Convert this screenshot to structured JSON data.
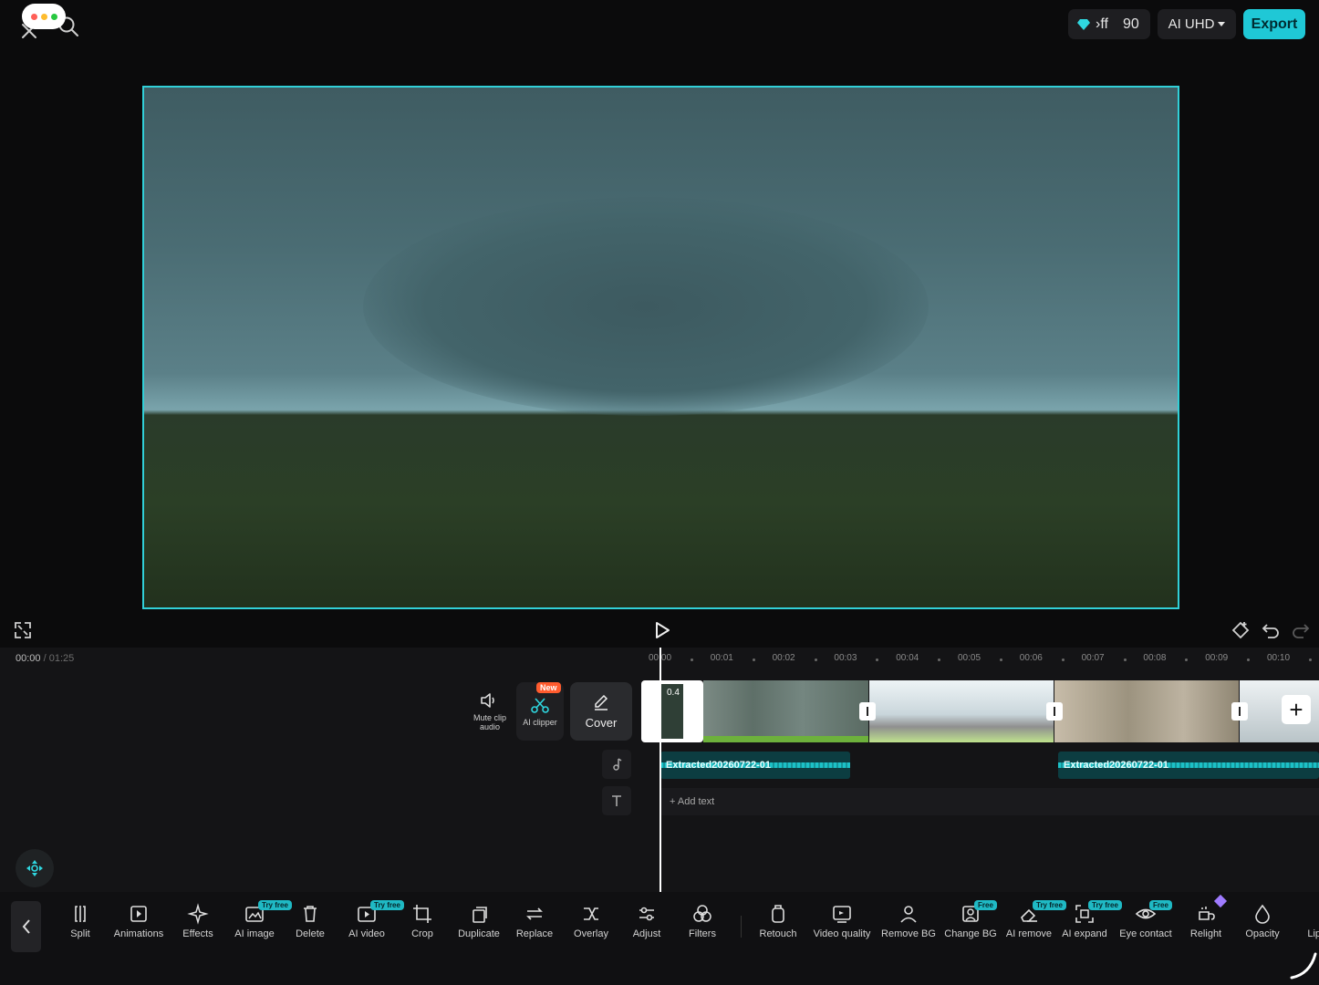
{
  "header": {
    "pro_label": "›ff",
    "credits": "90",
    "quality_label": "AI UHD",
    "export_label": "Export"
  },
  "player": {
    "current_time": "00:00",
    "separator": "/",
    "duration": "01:25"
  },
  "ruler": {
    "ticks": [
      "00:00",
      "00:01",
      "00:02",
      "00:03",
      "00:04",
      "00:05",
      "00:06",
      "00:07",
      "00:08",
      "00:09",
      "00:10"
    ]
  },
  "track_tools": {
    "mute_label": "Mute clip audio",
    "clipper_label": "AI clipper",
    "clipper_badge": "New",
    "cover_label": "Cover"
  },
  "timeline": {
    "clip_a_label": "0.4",
    "audio_clip_1": "Extracted20260722-01",
    "audio_clip_2": "Extracted20260722-01",
    "add_text_label": "+ Add text"
  },
  "toolbar": {
    "tools": [
      {
        "label": "Split",
        "badge": "",
        "icon": "split-icon"
      },
      {
        "label": "Animations",
        "badge": "",
        "icon": "animations-icon"
      },
      {
        "label": "Effects",
        "badge": "",
        "icon": "effects-icon"
      },
      {
        "label": "AI image",
        "badge": "Try free",
        "icon": "ai-image-icon"
      },
      {
        "label": "Delete",
        "badge": "",
        "icon": "delete-icon"
      },
      {
        "label": "AI video",
        "badge": "Try free",
        "icon": "ai-video-icon"
      },
      {
        "label": "Crop",
        "badge": "",
        "icon": "crop-icon"
      },
      {
        "label": "Duplicate",
        "badge": "",
        "icon": "duplicate-icon"
      },
      {
        "label": "Replace",
        "badge": "",
        "icon": "replace-icon"
      },
      {
        "label": "Overlay",
        "badge": "",
        "icon": "overlay-icon"
      },
      {
        "label": "Adjust",
        "badge": "",
        "icon": "adjust-icon"
      },
      {
        "label": "Filters",
        "badge": "",
        "icon": "filters-icon"
      },
      {
        "label": "Retouch",
        "badge": "",
        "icon": "retouch-icon"
      },
      {
        "label": "Video quality",
        "badge": "",
        "icon": "video-quality-icon"
      },
      {
        "label": "Remove BG",
        "badge": "",
        "icon": "remove-bg-icon"
      },
      {
        "label": "Change BG",
        "badge": "Free",
        "icon": "change-bg-icon"
      },
      {
        "label": "AI remove",
        "badge": "Try free",
        "icon": "ai-remove-icon"
      },
      {
        "label": "AI expand",
        "badge": "Try free",
        "icon": "ai-expand-icon"
      },
      {
        "label": "Eye contact",
        "badge": "Free",
        "icon": "eye-contact-icon"
      },
      {
        "label": "Relight",
        "badge": "",
        "icon": "relight-icon"
      },
      {
        "label": "Opacity",
        "badge": "",
        "icon": "opacity-icon"
      },
      {
        "label": "Lip s",
        "badge": "",
        "icon": "lip-sync-icon"
      }
    ]
  },
  "colors": {
    "accent": "#1fc8d6",
    "frame_border": "#31d0d8",
    "new_badge": "#ff5b2e",
    "panel": "#141416"
  }
}
